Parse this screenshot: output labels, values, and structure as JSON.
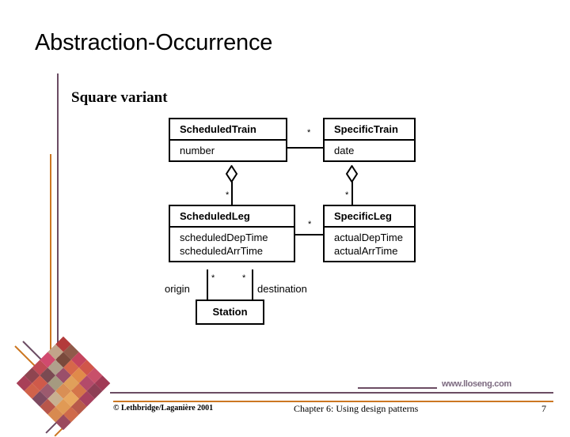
{
  "slide": {
    "title": "Abstraction-Occurrence",
    "subtitle": "Square variant"
  },
  "diagram": {
    "classes": [
      {
        "id": "scheduled-train",
        "name": "ScheduledTrain",
        "attributes": [
          "number"
        ]
      },
      {
        "id": "specific-train",
        "name": "SpecificTrain",
        "attributes": [
          "date"
        ]
      },
      {
        "id": "scheduled-leg",
        "name": "ScheduledLeg",
        "attributes": [
          "scheduledDepTime",
          "scheduledArrTime"
        ]
      },
      {
        "id": "specific-leg",
        "name": "SpecificLeg",
        "attributes": [
          "actualDepTime",
          "actualArrTime"
        ]
      },
      {
        "id": "station",
        "name": "Station",
        "attributes": []
      }
    ],
    "multiplicities": {
      "train_association": "*",
      "leg_association": "*",
      "scheduled_leg_aggregation": "*",
      "specific_leg_aggregation": "*",
      "origin": "*",
      "destination": "*"
    },
    "roles": {
      "origin": "origin",
      "destination": "destination"
    }
  },
  "footer": {
    "copyright": "© Lethbridge/Laganière 2001",
    "chapter": "Chapter 6: Using design patterns",
    "page": "7",
    "website": "www.lloseng.com"
  },
  "colors": {
    "rule_purple": "#6b4c63",
    "rule_orange": "#cc7722",
    "website_text": "#7c6a80",
    "diagram_line": "#000000"
  },
  "logo_mosaic": [
    [
      "#b33b3b",
      "#8f5a4a",
      "#c4455e",
      "#d0564a",
      "#c8506a",
      "#a03a55"
    ],
    [
      "#c2a48a",
      "#7a4a3c",
      "#d6674a",
      "#e08a4a",
      "#b34a6a",
      "#8e3f55"
    ],
    [
      "#d14a6e",
      "#b0a08c",
      "#9a4f6a",
      "#e0a05a",
      "#d4754a",
      "#a8415e"
    ],
    [
      "#c04a55",
      "#7b4a52",
      "#a59a80",
      "#d98f55",
      "#e8a860",
      "#b85a4a"
    ],
    [
      "#8f4550",
      "#cf5a4a",
      "#9c5a6e",
      "#c8b090",
      "#e09a55",
      "#cf6a4a"
    ],
    [
      "#a83f58",
      "#d1624a",
      "#7e4a60",
      "#b8564a",
      "#d88a50",
      "#9b4a5e"
    ]
  ]
}
